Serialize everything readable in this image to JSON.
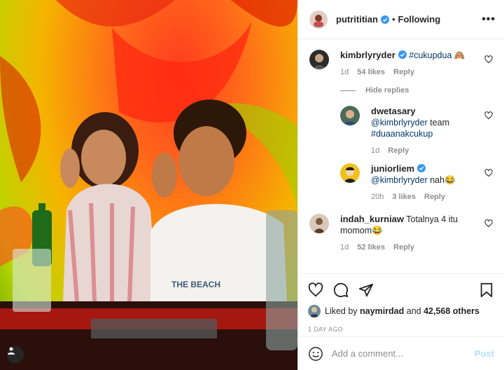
{
  "post": {
    "author": "putrititian",
    "following_label": "Following",
    "more_label": "•••"
  },
  "comments": [
    {
      "username": "kimbrlyryder",
      "verified": true,
      "text": "#cukupdua",
      "emoji": "🙈",
      "time": "1d",
      "likes": "54 likes",
      "reply_label": "Reply"
    }
  ],
  "hide_replies_label": "Hide replies",
  "replies": [
    {
      "username": "dwetasary",
      "mention": "@kimbrlyryder",
      "text": " team",
      "hashtag": "#duaanakcukup",
      "time": "1d",
      "reply_label": "Reply"
    },
    {
      "username": "juniorliem",
      "verified": true,
      "mention": "@kimbrlyryder",
      "text": " nah",
      "emoji": "😂",
      "time": "20h",
      "likes": "3 likes",
      "reply_label": "Reply"
    }
  ],
  "comment2": {
    "username": "indah_kurniaw",
    "text": " Totalnya 4 itu momom",
    "emoji": "😂",
    "time": "1d",
    "likes": "52 likes",
    "reply_label": "Reply"
  },
  "likes": {
    "prefix": "Liked by ",
    "user": "naymirdad",
    "middle": " and ",
    "count": "42,568 others"
  },
  "timestamp": "1 DAY AGO",
  "add_comment": {
    "placeholder": "Add a comment...",
    "post_label": "Post"
  },
  "colors": {
    "link": "#00376b",
    "verified": "#3897f0",
    "muted": "#8e8e8e",
    "post_disabled": "#b2dffc"
  },
  "icons": [
    "like-icon",
    "comment-icon",
    "share-icon",
    "save-icon",
    "emoji-icon",
    "user-tag-icon",
    "verified-icon"
  ]
}
